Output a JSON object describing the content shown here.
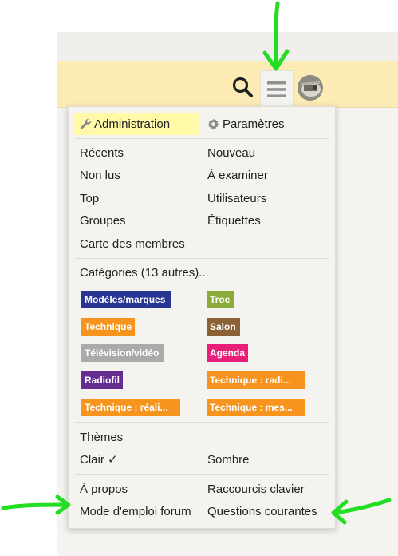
{
  "header": {
    "background": "#fdebb5",
    "icons": [
      "search-icon",
      "hamburger-menu-icon",
      "user-avatar"
    ]
  },
  "menu": {
    "admin_label": "Administration",
    "settings_label": "Paramètres",
    "nav_left": [
      "Récents",
      "Non lus",
      "Top",
      "Groupes",
      "Carte des membres"
    ],
    "nav_right": [
      "Nouveau",
      "À examiner",
      "Utilisateurs",
      "Étiquettes"
    ],
    "categories_label": "Catégories (13 autres)...",
    "categories": [
      {
        "label": "Modèles/marques",
        "color": "#283593"
      },
      {
        "label": "Troc",
        "color": "#8bab38"
      },
      {
        "label": "Technique",
        "color": "#f7941d"
      },
      {
        "label": "Salon",
        "color": "#8a6236"
      },
      {
        "label": "Télévision/vidéo",
        "color": "#aaaaaa"
      },
      {
        "label": "Agenda",
        "color": "#e91e79"
      },
      {
        "label": "Radiofil",
        "color": "#652d90"
      },
      {
        "label": "Technique : radi...",
        "color": "#f7941d"
      },
      {
        "label": "Technique : réali...",
        "color": "#f7941d"
      },
      {
        "label": "Technique : mes...",
        "color": "#f7941d"
      }
    ],
    "themes_label": "Thèmes",
    "theme_light": "Clair ✓",
    "theme_dark": "Sombre",
    "footer_left": [
      "À propos",
      "Mode d'emploi forum"
    ],
    "footer_right": [
      "Raccourcis clavier",
      "Questions courantes"
    ]
  },
  "annotations": {
    "arrow_color": "#22dd22"
  }
}
